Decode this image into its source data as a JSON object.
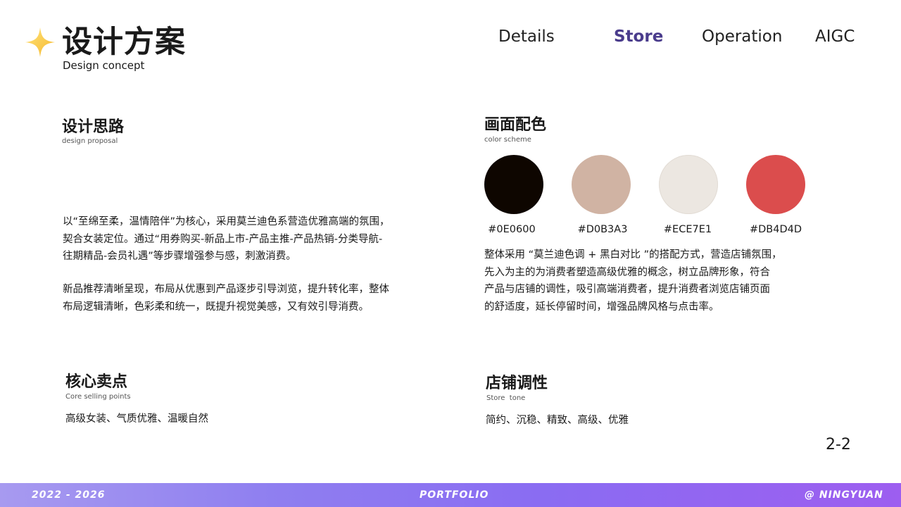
{
  "header": {
    "title": "设计方案",
    "subtitle": "Design concept",
    "icon": "sparkle-icon",
    "nav": [
      {
        "label": "Details"
      },
      {
        "label": "Store"
      },
      {
        "label": "Operation"
      },
      {
        "label": "AIGC"
      }
    ],
    "active_nav": "Store"
  },
  "design_proposal": {
    "title": "设计思路",
    "subtitle": "design proposal",
    "paragraphs": [
      [
        "以“至绵至柔，温情陪伴”为核心，采用莫兰迪色系营造优雅高端的氛围，",
        "契合女装定位。通过“用券购买-新品上市-产品主推-产品热销-分类导航-",
        "往期精品-会员礼遇”等步骤增强参与感，刺激消费。"
      ],
      [
        "新品推荐清晰呈现，布局从优惠到产品逐步引导浏览，提升转化率，整体",
        "布局逻辑清晰，色彩柔和统一，既提升视觉美感，又有效引导消费。"
      ]
    ]
  },
  "color_scheme": {
    "title": "画面配色",
    "subtitle": "color scheme",
    "colors": [
      {
        "hex": "#0E0600",
        "label": "#0E0600"
      },
      {
        "hex": "#D0B3A3",
        "label": "#D0B3A3"
      },
      {
        "hex": "#ECE7E1",
        "label": "#ECE7E1"
      },
      {
        "hex": "#DB4D4D",
        "label": "#DB4D4D"
      }
    ],
    "lines": [
      "整体采用 “莫兰迪色调 + 黑白对比 ”的搭配方式，营造店铺氛围，",
      "先入为主的为消费者塑造高级优雅的概念，树立品牌形象，符合",
      "产品与店铺的调性，吸引高端消费者，提升消费者浏览店铺页面",
      "的舒适度，延长停留时间，增强品牌风格与点击率。"
    ]
  },
  "core_selling": {
    "title": "核心卖点",
    "subtitle": "Core selling points",
    "text": "高级女装、气质优雅、温暖自然"
  },
  "store_tone": {
    "title": "店铺调性",
    "subtitle": "Store  tone",
    "text": "简约、沉稳、精致、高级、优雅"
  },
  "page_number": "2-2",
  "footer": {
    "left": "2022 - 2026",
    "center": "PORTFOLIO",
    "right": "@ NINGYUAN"
  }
}
